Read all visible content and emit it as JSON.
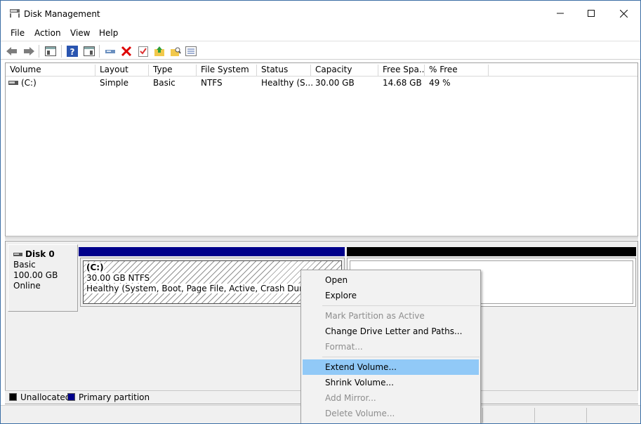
{
  "window": {
    "title": "Disk Management"
  },
  "menu": [
    "File",
    "Action",
    "View",
    "Help"
  ],
  "toolbar": {
    "icons": [
      "back-arrow-icon",
      "forward-arrow-icon",
      "console-tree-icon",
      "help-icon",
      "properties-icon",
      "connect-icon",
      "delete-icon",
      "check-icon",
      "folder-up-icon",
      "folder-search-icon",
      "list-icon"
    ]
  },
  "volume_list": {
    "columns": [
      "Volume",
      "Layout",
      "Type",
      "File System",
      "Status",
      "Capacity",
      "Free Spa...",
      "% Free"
    ],
    "rows": [
      {
        "volume": "(C:)",
        "layout": "Simple",
        "type": "Basic",
        "filesystem": "NTFS",
        "status": "Healthy (S...",
        "capacity": "30.00 GB",
        "free": "14.68 GB",
        "pct_free": "49 %"
      }
    ]
  },
  "disk": {
    "name": "Disk 0",
    "type": "Basic",
    "size": "100.00 GB",
    "state": "Online",
    "partition_c": {
      "label": "(C:)",
      "size_fs": "30.00 GB NTFS",
      "status": "Healthy (System, Boot, Page File, Active, Crash Dump, Prim"
    }
  },
  "legend": {
    "unallocated": "Unallocated",
    "primary": "Primary partition"
  },
  "context_menu": {
    "items": [
      {
        "label": "Open",
        "enabled": true
      },
      {
        "label": "Explore",
        "enabled": true
      },
      {
        "label": "Mark Partition as Active",
        "enabled": false
      },
      {
        "label": "Change Drive Letter and Paths...",
        "enabled": true
      },
      {
        "label": "Format...",
        "enabled": false
      },
      {
        "label": "Extend Volume...",
        "enabled": true,
        "highlighted": true
      },
      {
        "label": "Shrink Volume...",
        "enabled": true
      },
      {
        "label": "Add Mirror...",
        "enabled": false
      },
      {
        "label": "Delete Volume...",
        "enabled": false
      }
    ]
  },
  "colors": {
    "primary_partition": "#00008b",
    "unallocated": "#000000",
    "highlight": "#91c9f7"
  }
}
